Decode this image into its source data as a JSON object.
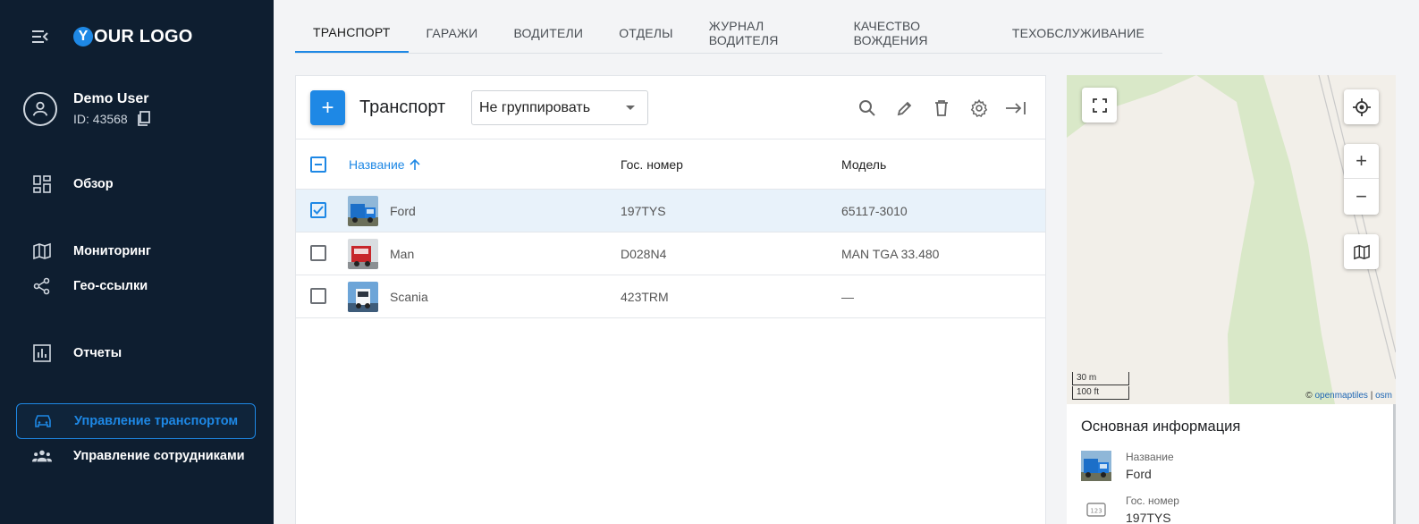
{
  "brand": {
    "logo_letter": "Y",
    "logo_text": "OUR LOGO"
  },
  "user": {
    "name": "Demo User",
    "id": "ID: 43568"
  },
  "sidebar": {
    "items": [
      {
        "label": "Обзор",
        "icon": "dashboard-icon"
      },
      {
        "label": "Мониторинг",
        "icon": "map-icon"
      },
      {
        "label": "Гео-ссылки",
        "icon": "share-icon"
      },
      {
        "label": "Отчеты",
        "icon": "bar-chart-icon"
      },
      {
        "label": "Управление транспортом",
        "icon": "car-icon",
        "active": true
      },
      {
        "label": "Управление сотрудниками",
        "icon": "people-icon"
      }
    ]
  },
  "tabs": [
    {
      "label": "ТРАНСПОРТ",
      "active": true
    },
    {
      "label": "ГАРАЖИ"
    },
    {
      "label": "ВОДИТЕЛИ"
    },
    {
      "label": "ОТДЕЛЫ"
    },
    {
      "label": "ЖУРНАЛ ВОДИТЕЛЯ"
    },
    {
      "label": "КАЧЕСТВО ВОЖДЕНИЯ"
    },
    {
      "label": "ТЕХОБСЛУЖИВАНИЕ"
    }
  ],
  "toolbar": {
    "add_label": "+",
    "title": "Транспорт",
    "group_select_value": "Не группировать"
  },
  "table": {
    "columns": {
      "name": "Название",
      "plate": "Гос. номер",
      "model": "Модель"
    },
    "rows": [
      {
        "name": "Ford",
        "plate": "197TYS",
        "model": "65117-3010",
        "checked": true
      },
      {
        "name": "Man",
        "plate": "D028N4",
        "model": "MAN TGA 33.480",
        "checked": false
      },
      {
        "name": "Scania",
        "plate": "423TRM",
        "model": "—",
        "checked": false
      }
    ]
  },
  "map": {
    "scale_metric": "30 m",
    "scale_imperial": "100 ft",
    "attribution_prefix": "© ",
    "attribution_link1": "openmaptiles",
    "attribution_sep": " | ",
    "attribution_link2": "osm",
    "zoom_in": "+",
    "zoom_out": "−"
  },
  "info": {
    "title": "Основная информация",
    "name_label": "Название",
    "name_value": "Ford",
    "plate_label": "Гос. номер",
    "plate_value": "197TYS"
  },
  "colors": {
    "sidebar_bg": "#0e1e30",
    "accent": "#1e88e5",
    "selected_row": "#e8f2fa"
  }
}
